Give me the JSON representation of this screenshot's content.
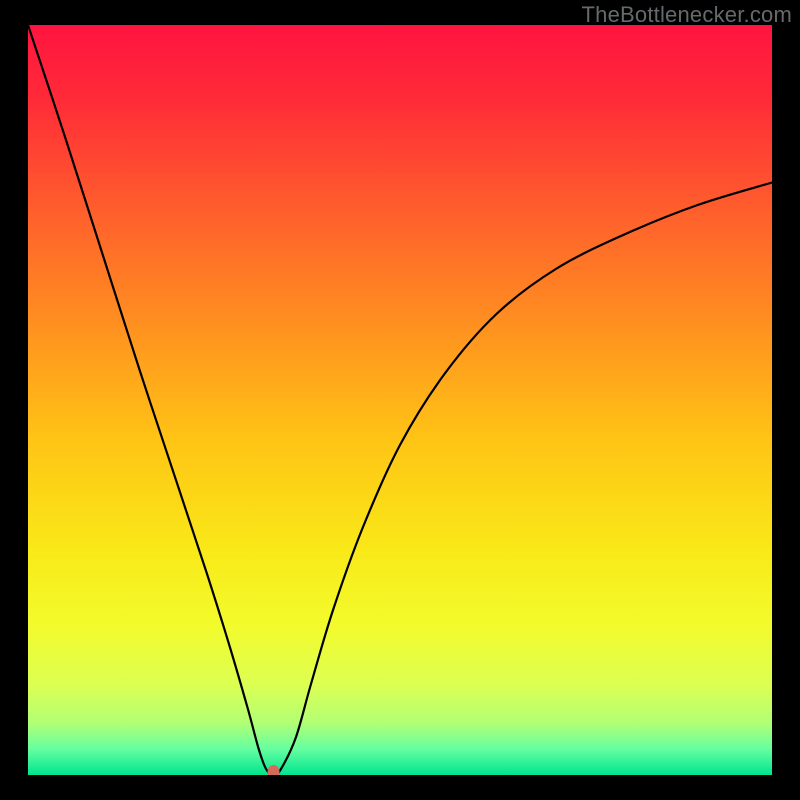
{
  "watermark": "TheBottlenecker.com",
  "chart_data": {
    "type": "line",
    "title": "",
    "xlabel": "",
    "ylabel": "",
    "xlim": [
      0,
      100
    ],
    "ylim": [
      0,
      100
    ],
    "background": {
      "gradient_stops": [
        {
          "pos": 0.0,
          "color": "#ff1440"
        },
        {
          "pos": 0.1,
          "color": "#ff2b38"
        },
        {
          "pos": 0.25,
          "color": "#ff5f2c"
        },
        {
          "pos": 0.4,
          "color": "#ff9020"
        },
        {
          "pos": 0.55,
          "color": "#ffc315"
        },
        {
          "pos": 0.7,
          "color": "#f9e918"
        },
        {
          "pos": 0.8,
          "color": "#f3fb2c"
        },
        {
          "pos": 0.88,
          "color": "#dcff52"
        },
        {
          "pos": 0.93,
          "color": "#b2ff74"
        },
        {
          "pos": 0.965,
          "color": "#66ffa0"
        },
        {
          "pos": 1.0,
          "color": "#00e58f"
        }
      ]
    },
    "x": [
      0,
      5,
      10,
      15,
      20,
      24,
      27,
      29.5,
      31,
      32,
      33,
      34,
      36,
      38,
      41,
      45,
      50,
      56,
      63,
      71,
      80,
      90,
      100
    ],
    "values": [
      100,
      85,
      69.5,
      54,
      39,
      27,
      17.5,
      9,
      3.5,
      0.8,
      0,
      0.8,
      5,
      12,
      22,
      33,
      44,
      53.5,
      61.5,
      67.5,
      72,
      76,
      79
    ],
    "marker": {
      "x": 33,
      "y": 0,
      "color": "#d46a5a",
      "rx": 6,
      "ry": 7
    }
  }
}
